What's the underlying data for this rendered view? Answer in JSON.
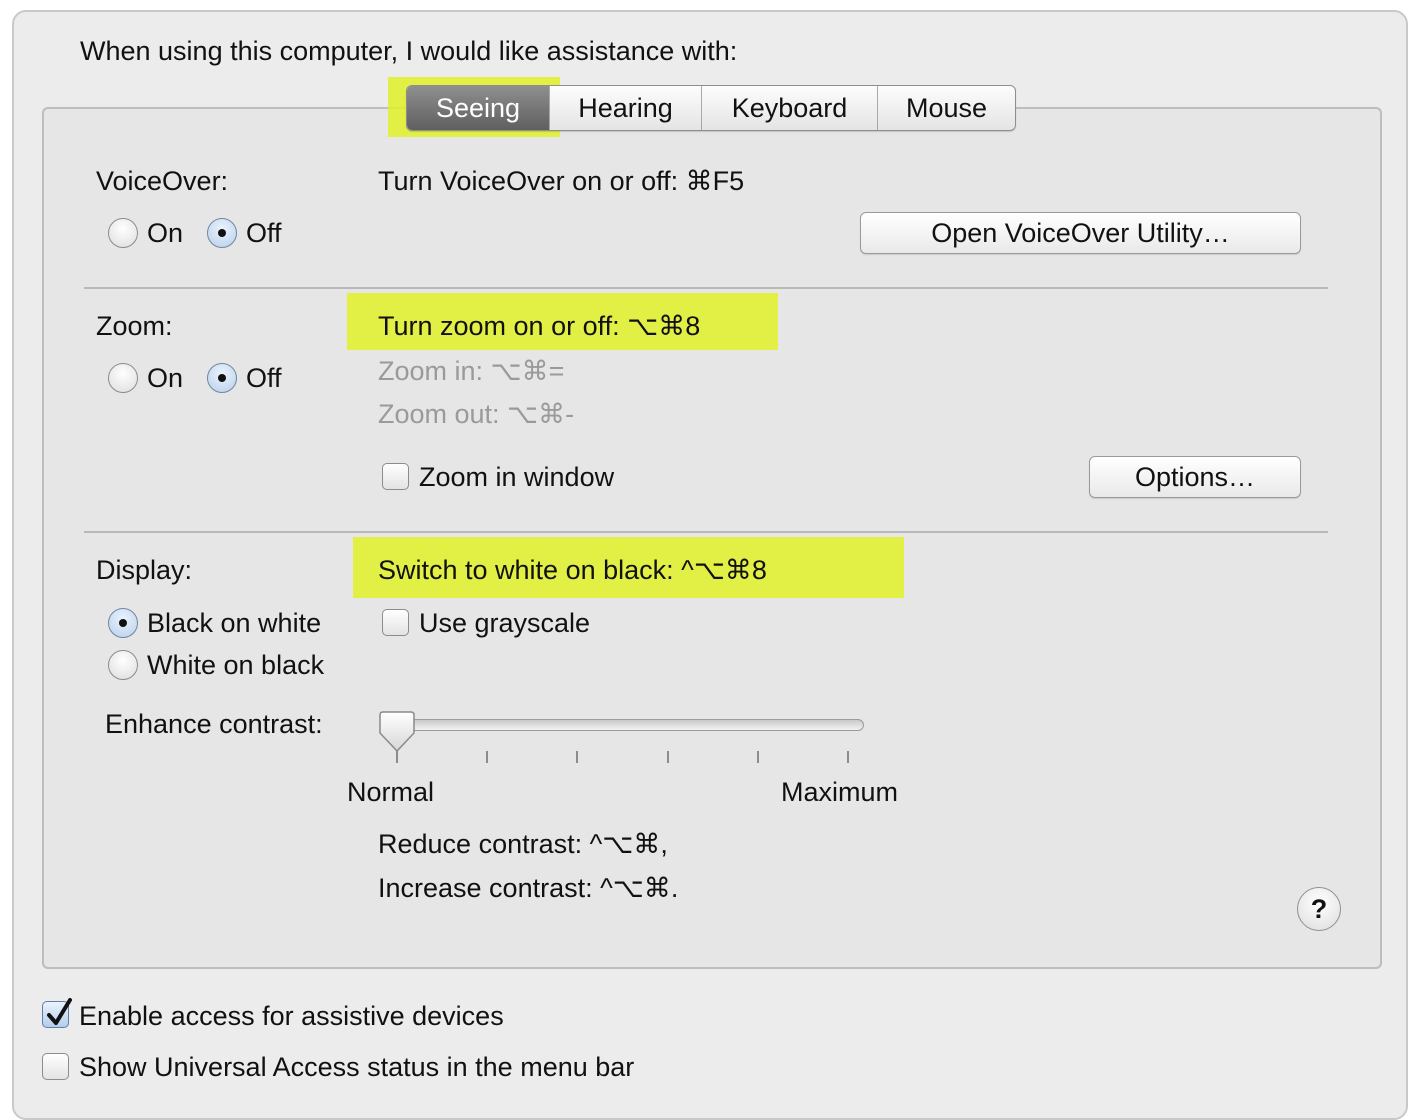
{
  "intro": "When using this computer, I would like assistance with:",
  "tabs": [
    "Seeing",
    "Hearing",
    "Keyboard",
    "Mouse"
  ],
  "voiceover": {
    "label": "VoiceOver:",
    "shortcut": "Turn VoiceOver on or off: ⌘F5",
    "on_label": "On",
    "off_label": "Off",
    "selected": "Off",
    "utility_button": "Open VoiceOver Utility…"
  },
  "zoom": {
    "label": "Zoom:",
    "shortcut": "Turn zoom on or off: ⌥⌘8",
    "zoom_in": "Zoom in: ⌥⌘=",
    "zoom_out": "Zoom out: ⌥⌘-",
    "on_label": "On",
    "off_label": "Off",
    "selected": "Off",
    "window_checkbox": "Zoom in window",
    "window_checked": false,
    "options_button": "Options…"
  },
  "display": {
    "label": "Display:",
    "shortcut": "Switch to white on black: ^⌥⌘8",
    "black_on_white": "Black on white",
    "white_on_black": "White on black",
    "selected": "Black on white",
    "grayscale": "Use grayscale",
    "grayscale_checked": false,
    "contrast_label": "Enhance contrast:",
    "contrast_min": "Normal",
    "contrast_max": "Maximum",
    "contrast_value": 0,
    "reduce": "Reduce contrast: ^⌥⌘,",
    "increase": "Increase contrast: ^⌥⌘."
  },
  "help": "?",
  "footer": {
    "assistive": "Enable access for assistive devices",
    "assistive_checked": true,
    "status_menu": "Show Universal Access status in the menu bar",
    "status_checked": false
  },
  "highlight_color": "#e1f028"
}
